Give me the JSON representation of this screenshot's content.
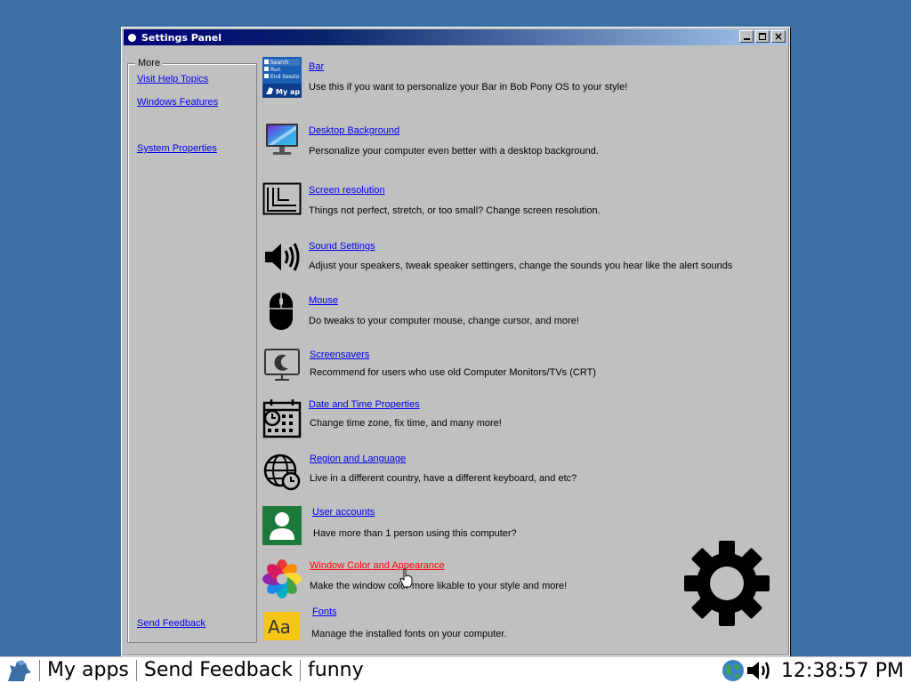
{
  "window": {
    "title": "Settings Panel",
    "minimize_label": "",
    "maximize_label": "",
    "close_label": "×"
  },
  "sidebar": {
    "title": "More",
    "links": [
      {
        "label": "Visit Help Topics"
      },
      {
        "label": "Windows Features"
      },
      {
        "label": "System Properties"
      }
    ],
    "feedback_label": "Send Feedback"
  },
  "items": [
    {
      "title": "Bar",
      "desc": "Use this if you want to personalize your Bar in Bob Pony OS to your style!",
      "icon": "bar-icon"
    },
    {
      "title": "Desktop Background",
      "desc": "Personalize your computer even better with a desktop background.",
      "icon": "monitor-icon"
    },
    {
      "title": "Screen resolution",
      "desc": "Things not perfect, stretch, or too small? Change screen resolution.",
      "icon": "resolution-icon"
    },
    {
      "title": "Sound Settings",
      "desc": "Adjust your speakers, tweak speaker settingers, change the sounds you hear like the alert sounds",
      "icon": "speaker-icon"
    },
    {
      "title": "Mouse",
      "desc": "Do tweaks to your computer mouse, change cursor, and more!",
      "icon": "mouse-icon"
    },
    {
      "title": "Screensavers",
      "desc": "Recommend for users who use old Computer Monitors/TVs (CRT)",
      "icon": "screensaver-icon"
    },
    {
      "title": "Date and Time Properties",
      "desc": "Change time zone, fix time, and many more!",
      "icon": "calendar-clock-icon"
    },
    {
      "title": "Region and Language",
      "desc": "Live in a different country, have a different keyboard, and etc?",
      "icon": "globe-clock-icon"
    },
    {
      "title": "User accounts",
      "desc": "Have more than 1 person using this computer?",
      "icon": "user-icon"
    },
    {
      "title": "Window Color and Appearance",
      "desc": "Make the window color more likable to your style and more!",
      "icon": "color-wheel-icon"
    },
    {
      "title": "Fonts",
      "desc": "Manage the installed fonts on your computer.",
      "icon": "fonts-icon"
    }
  ],
  "bar_icon_text": {
    "line1": "Search",
    "line2": "Run",
    "line3": "End Session",
    "line4": "My apps"
  },
  "fonts_icon_text": "Aa",
  "taskbar": {
    "items": [
      "My apps",
      "Send Feedback",
      "funny"
    ],
    "clock": "12:38:57 PM"
  },
  "colors": {
    "desktop": "#3a6ea5",
    "window": "#c0c0c0",
    "link": "#0000ee",
    "link_hover": "#ff0000",
    "user_icon_bg": "#1e7a3c",
    "fonts_icon_bg": "#f5c518"
  }
}
